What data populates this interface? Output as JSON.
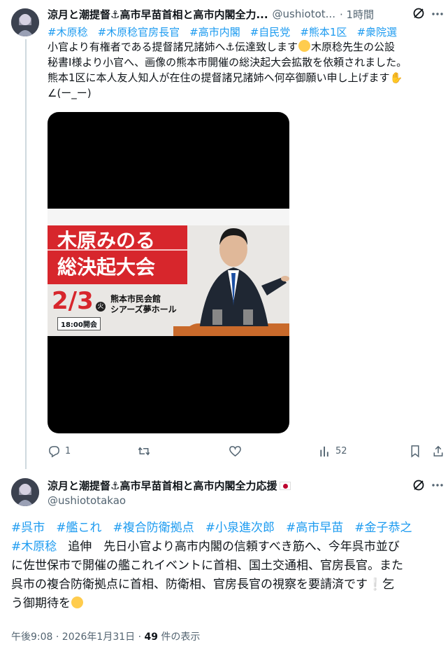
{
  "tweet1": {
    "name": "涼月と潮提督⚓高市早苗首相と高市内閣全力...",
    "handle": "@ushiotot...",
    "time": "· 1時間",
    "hashtags": [
      "#木原稔",
      "#木原稔官房長官",
      "#高市内閣",
      "#自民党",
      "#熊本1区",
      "#衆院選"
    ],
    "line1a": "小官より有権者である提督諸兄諸姉へ⚓伝達致します",
    "line1b": "木原稔先生の公設",
    "line2": "秘書I様より小官へ、画像の熊本市開催の総決起大会拡散を依頼されました。",
    "line3a": "熊本1区に本人友人知人が在住の提督諸兄諸姉へ何卒御願い申し上げます",
    "line4": "∠(ー_ー)",
    "image": {
      "title1": "木原みのる",
      "title2": "総決起大会",
      "date": "2/3",
      "weekday": "火",
      "venue1": "熊本市民会館",
      "venue2": "シアーズ夢ホール",
      "open_time": "18:00開会"
    },
    "actions": {
      "reply_count": "1",
      "retweet_count": "",
      "like_count": "",
      "view_count": "52"
    }
  },
  "tweet2": {
    "name": "涼月と潮提督⚓高市早苗首相と高市内閣全力応援",
    "handle": "@ushiototakao",
    "hashtags_row1": [
      "#呉市",
      "#艦これ",
      "#複合防衛拠点",
      "#小泉進次郎",
      "#高市早苗",
      "#金子恭之"
    ],
    "hashtag_row2": "#木原稔",
    "line2_text": "追伸　先日小官より高市内閣の信頼すべき筋へ、今年呉市並び",
    "line3": "に佐世保市で開催の艦これイベントに首相、国土交通相、官房長官。また",
    "line4": "呉市の複合防衛拠点に首相、防衛相、官房長官の視察を要請済です❕乞",
    "line5": "う御期待を",
    "timestamp": "午後9:08 · 2026年1月31日 · ",
    "views_number": "49",
    "views_label": " 件の表示"
  },
  "colors": {
    "link": "#1d9bf0",
    "muted": "#536471",
    "banner_red": "#d7262c"
  },
  "icons": [
    "grok-icon",
    "more-icon",
    "reply-icon",
    "retweet-icon",
    "like-icon",
    "views-icon",
    "bookmark-icon",
    "share-icon"
  ]
}
